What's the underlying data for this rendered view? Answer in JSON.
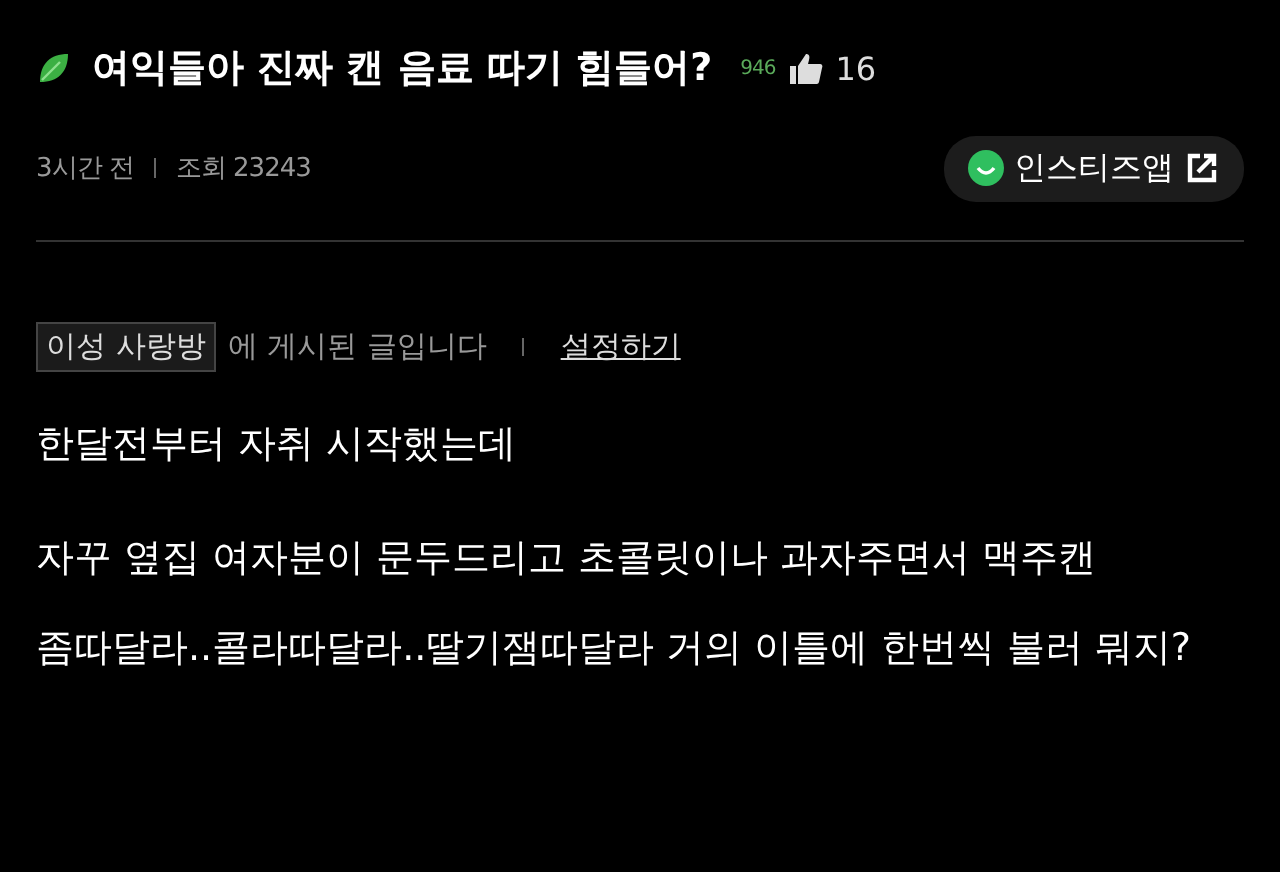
{
  "post": {
    "title": "여익들아 진짜 캔 음료 따기 힘들어?",
    "comment_count": "946",
    "likes": "16"
  },
  "meta": {
    "time": "3시간 전",
    "views": "조회 23243",
    "app_button": "인스티즈앱"
  },
  "board": {
    "name": "이성 사랑방",
    "notice": "에 게시된 글입니다",
    "settings_link": "설정하기"
  },
  "body": [
    "한달전부터 자취 시작했는데",
    "자꾸 옆집 여자분이 문두드리고 초콜릿이나 과자주면서 맥주캔 좀따달라..콜라따달라..딸기잼따달라 거의 이틀에 한번씩 불러 뭐지?"
  ]
}
